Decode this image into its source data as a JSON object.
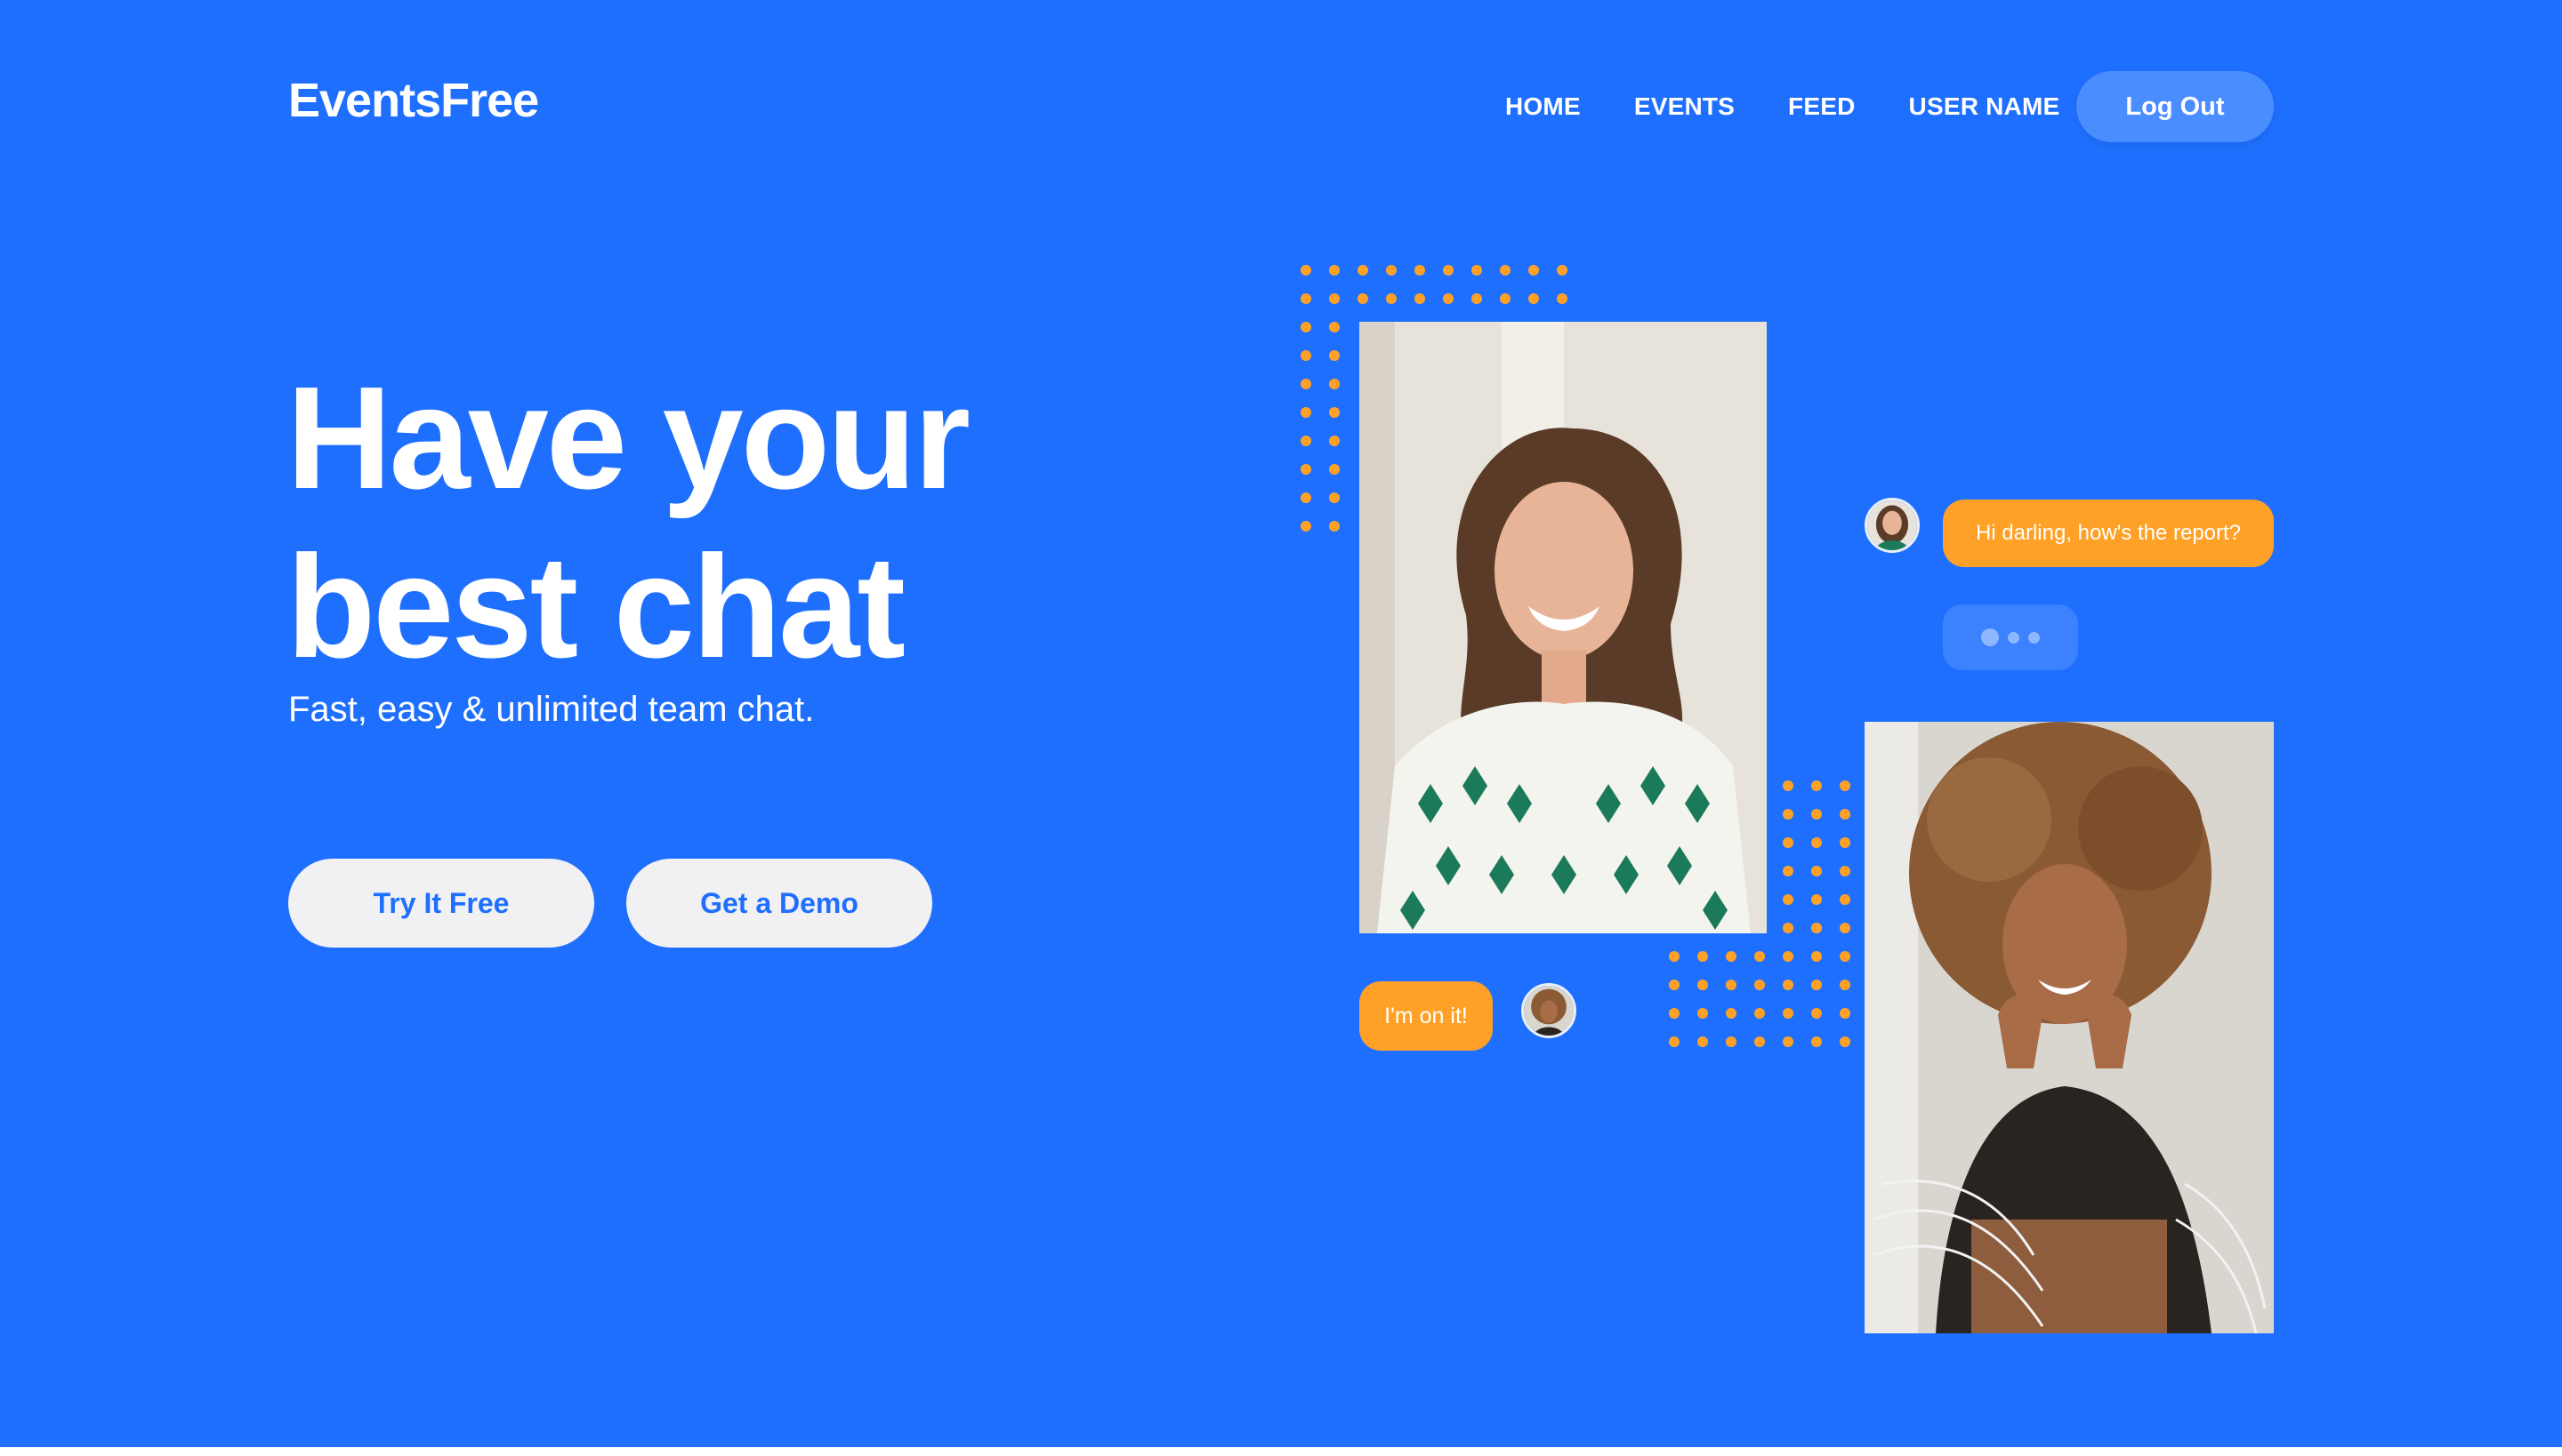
{
  "header": {
    "logo": "EventsFree",
    "nav": [
      "HOME",
      "EVENTS",
      "FEED",
      "USER NAME"
    ],
    "logout_label": "Log Out"
  },
  "hero": {
    "headline_line1": "Have your",
    "headline_line2": "best chat",
    "subtitle": "Fast, easy & unlimited team chat.",
    "primary_button": "Try It Free",
    "secondary_button": "Get a Demo"
  },
  "chat": {
    "message_1": "Hi darling, how's the report?",
    "message_2": "I'm on it!"
  },
  "colors": {
    "background": "#1f6fff",
    "accent": "#ffa126",
    "button_bg": "#f1f1f3"
  }
}
